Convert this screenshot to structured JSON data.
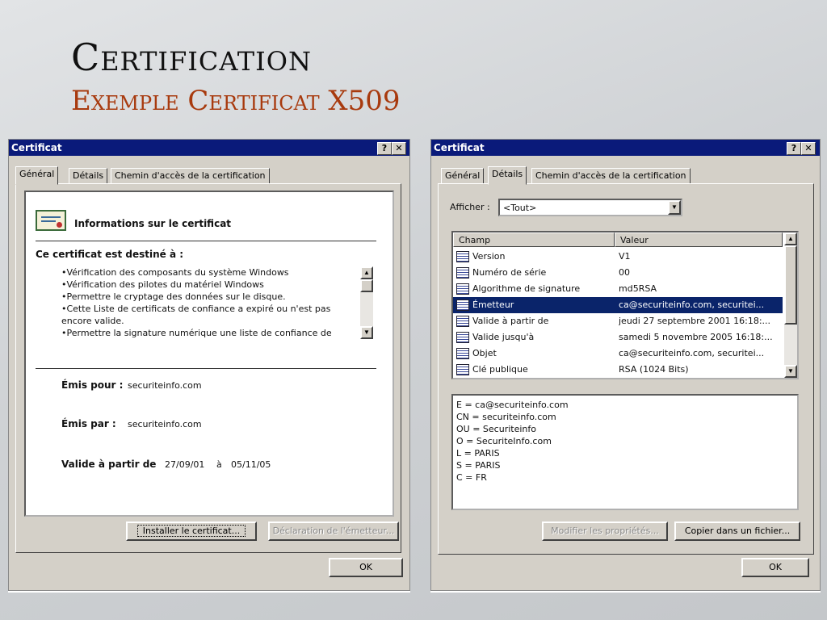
{
  "slide": {
    "title": "Certification",
    "subtitle": "Exemple Certificat X509"
  },
  "left_dialog": {
    "title": "Certificat",
    "help_btn": "?",
    "close_btn": "✕",
    "tabs": [
      "Général",
      "Détails",
      "Chemin d'accès de la certification"
    ],
    "info_heading": "Informations sur le certificat",
    "purpose_heading": "Ce certificat est destiné à :",
    "purposes": [
      "•Vérification des composants du système Windows",
      "•Vérification des pilotes du matériel Windows",
      "•Permettre le cryptage des données sur le disque.",
      "•Cette Liste de certificats de confiance a expiré ou n'est pas",
      "encore valide.",
      "•Permettre la signature numérique une liste de confiance de"
    ],
    "issued_to_label": "Émis pour :",
    "issued_to_value": "securiteinfo.com",
    "issued_by_label": "Émis par :",
    "issued_by_value": "securiteinfo.com",
    "valid_label": "Valide à partir de",
    "valid_from": "27/09/01",
    "valid_to_word": "à",
    "valid_to": "05/11/05",
    "install_btn": "Installer le certificat...",
    "issuer_stmt_btn": "Déclaration de l'émetteur...",
    "ok_btn": "OK"
  },
  "right_dialog": {
    "title": "Certificat",
    "help_btn": "?",
    "close_btn": "✕",
    "tabs": [
      "Général",
      "Détails",
      "Chemin d'accès de la certification"
    ],
    "show_label": "Afficher :",
    "show_value": "<Tout>",
    "col_field": "Champ",
    "col_value": "Valeur",
    "rows": [
      {
        "field": "Version",
        "value": "V1",
        "selected": false
      },
      {
        "field": "Numéro de série",
        "value": "00",
        "selected": false
      },
      {
        "field": "Algorithme de signature",
        "value": "md5RSA",
        "selected": false
      },
      {
        "field": "Émetteur",
        "value": "ca@securiteinfo.com, securitei...",
        "selected": true
      },
      {
        "field": "Valide à partir de",
        "value": "jeudi 27 septembre 2001 16:18:...",
        "selected": false
      },
      {
        "field": "Valide jusqu'à",
        "value": "samedi 5 novembre 2005 16:18:...",
        "selected": false
      },
      {
        "field": "Objet",
        "value": "ca@securiteinfo.com, securitei...",
        "selected": false
      },
      {
        "field": "Clé publique",
        "value": "RSA (1024 Bits)",
        "selected": false
      }
    ],
    "detail_lines": [
      "E = ca@securiteinfo.com",
      "CN = securiteinfo.com",
      "OU = Securiteinfo",
      "O = SecuriteInfo.com",
      "L = PARIS",
      "S = PARIS",
      "C = FR"
    ],
    "edit_props_btn": "Modifier les propriétés...",
    "copy_file_btn": "Copier dans un fichier...",
    "ok_btn": "OK"
  }
}
